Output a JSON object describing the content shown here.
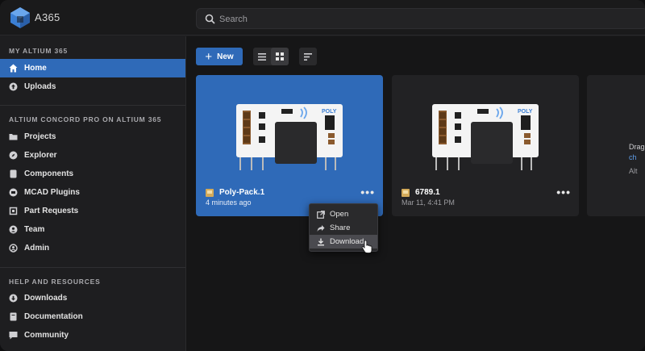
{
  "app": {
    "brand": "A365",
    "accent": "#2f6ab8"
  },
  "search": {
    "placeholder": "Search"
  },
  "sidebar": {
    "section1_title": "MY ALTIUM 365",
    "section1_items": [
      {
        "label": "Home",
        "icon": "home-icon",
        "active": true
      },
      {
        "label": "Uploads",
        "icon": "upload-icon",
        "active": false
      }
    ],
    "section2_title": "ALTIUM CONCORD PRO ON ALTIUM 365",
    "section2_items": [
      {
        "label": "Projects",
        "icon": "folder-icon"
      },
      {
        "label": "Explorer",
        "icon": "compass-icon"
      },
      {
        "label": "Components",
        "icon": "component-icon"
      },
      {
        "label": "MCAD Plugins",
        "icon": "plugin-icon"
      },
      {
        "label": "Part Requests",
        "icon": "part-request-icon"
      },
      {
        "label": "Team",
        "icon": "team-icon"
      },
      {
        "label": "Admin",
        "icon": "admin-icon"
      }
    ],
    "section3_title": "HELP AND RESOURCES",
    "section3_items": [
      {
        "label": "Downloads",
        "icon": "download-icon"
      },
      {
        "label": "Documentation",
        "icon": "book-icon"
      },
      {
        "label": "Community",
        "icon": "chat-icon"
      }
    ]
  },
  "toolbar": {
    "new_label": "New"
  },
  "cards": [
    {
      "title": "Poly-Pack.1",
      "subtitle": "4 minutes ago",
      "selected": true,
      "brand_mark": "POLY"
    },
    {
      "title": "6789.1",
      "subtitle": "Mar 11, 4:41 PM",
      "selected": false,
      "brand_mark": "POLY"
    }
  ],
  "partial_card": {
    "line1": "Drag",
    "line2": "ch",
    "line3": "Alt"
  },
  "context_menu": {
    "items": [
      {
        "label": "Open",
        "icon": "open-external-icon"
      },
      {
        "label": "Share",
        "icon": "share-icon"
      },
      {
        "label": "Download",
        "icon": "download-icon",
        "hovered": true
      }
    ]
  }
}
